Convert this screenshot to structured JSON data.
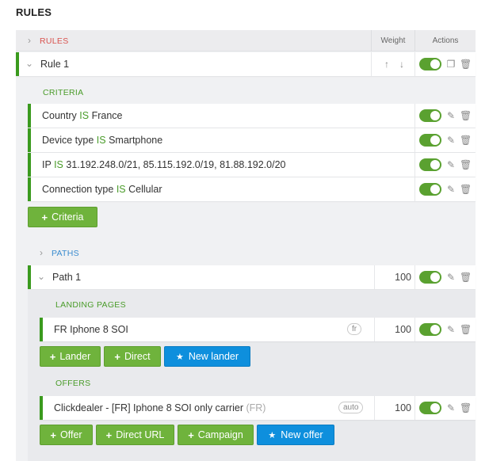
{
  "page": {
    "title": "RULES"
  },
  "header": {
    "section": "RULES",
    "weight": "Weight",
    "actions": "Actions"
  },
  "rule": {
    "name": "Rule 1"
  },
  "criteria": {
    "label": "CRITERIA",
    "items": [
      {
        "field": "Country",
        "op": "IS",
        "value": "France"
      },
      {
        "field": "Device type",
        "op": "IS",
        "value": "Smartphone"
      },
      {
        "field": "IP",
        "op": "IS",
        "value": "31.192.248.0/21, 85.115.192.0/19, 81.88.192.0/20"
      },
      {
        "field": "Connection type",
        "op": "IS",
        "value": "Cellular"
      }
    ],
    "add_button": "Criteria"
  },
  "paths": {
    "label": "PATHS",
    "path": {
      "name": "Path 1",
      "weight": "100"
    },
    "landing_pages": {
      "label": "LANDING PAGES",
      "items": [
        {
          "name": "FR Iphone 8 SOI",
          "tag": "fr",
          "weight": "100"
        }
      ],
      "buttons": {
        "lander": "Lander",
        "direct": "Direct",
        "new_lander": "New lander"
      }
    },
    "offers": {
      "label": "OFFERS",
      "items": [
        {
          "name": "Clickdealer - [FR] Iphone 8 SOI only carrier",
          "country": "(FR)",
          "tag": "auto",
          "weight": "100"
        }
      ],
      "buttons": {
        "offer": "Offer",
        "direct_url": "Direct URL",
        "campaign": "Campaign",
        "new_offer": "New offer"
      }
    }
  },
  "colors": {
    "accent_green": "#3a9a1e",
    "toggle_green": "#5aa130",
    "button_green": "#6fb33c",
    "button_blue": "#0e8fdd",
    "label_red": "#d9534f",
    "label_blue": "#3a8ccf"
  },
  "icons": [
    "chevron-right-icon",
    "chevron-down-icon",
    "arrow-up-icon",
    "arrow-down-icon",
    "copy-icon",
    "trash-icon",
    "pencil-icon",
    "star-icon",
    "plus-icon"
  ]
}
